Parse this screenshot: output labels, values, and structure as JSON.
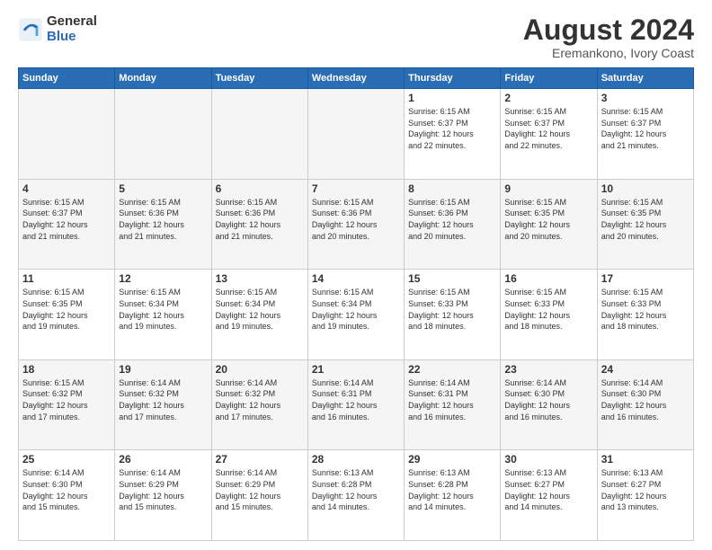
{
  "header": {
    "logo_general": "General",
    "logo_blue": "Blue",
    "month_year": "August 2024",
    "location": "Eremankono, Ivory Coast"
  },
  "days_of_week": [
    "Sunday",
    "Monday",
    "Tuesday",
    "Wednesday",
    "Thursday",
    "Friday",
    "Saturday"
  ],
  "weeks": [
    [
      {
        "day": "",
        "info": ""
      },
      {
        "day": "",
        "info": ""
      },
      {
        "day": "",
        "info": ""
      },
      {
        "day": "",
        "info": ""
      },
      {
        "day": "1",
        "info": "Sunrise: 6:15 AM\nSunset: 6:37 PM\nDaylight: 12 hours\nand 22 minutes."
      },
      {
        "day": "2",
        "info": "Sunrise: 6:15 AM\nSunset: 6:37 PM\nDaylight: 12 hours\nand 22 minutes."
      },
      {
        "day": "3",
        "info": "Sunrise: 6:15 AM\nSunset: 6:37 PM\nDaylight: 12 hours\nand 21 minutes."
      }
    ],
    [
      {
        "day": "4",
        "info": "Sunrise: 6:15 AM\nSunset: 6:37 PM\nDaylight: 12 hours\nand 21 minutes."
      },
      {
        "day": "5",
        "info": "Sunrise: 6:15 AM\nSunset: 6:36 PM\nDaylight: 12 hours\nand 21 minutes."
      },
      {
        "day": "6",
        "info": "Sunrise: 6:15 AM\nSunset: 6:36 PM\nDaylight: 12 hours\nand 21 minutes."
      },
      {
        "day": "7",
        "info": "Sunrise: 6:15 AM\nSunset: 6:36 PM\nDaylight: 12 hours\nand 20 minutes."
      },
      {
        "day": "8",
        "info": "Sunrise: 6:15 AM\nSunset: 6:36 PM\nDaylight: 12 hours\nand 20 minutes."
      },
      {
        "day": "9",
        "info": "Sunrise: 6:15 AM\nSunset: 6:35 PM\nDaylight: 12 hours\nand 20 minutes."
      },
      {
        "day": "10",
        "info": "Sunrise: 6:15 AM\nSunset: 6:35 PM\nDaylight: 12 hours\nand 20 minutes."
      }
    ],
    [
      {
        "day": "11",
        "info": "Sunrise: 6:15 AM\nSunset: 6:35 PM\nDaylight: 12 hours\nand 19 minutes."
      },
      {
        "day": "12",
        "info": "Sunrise: 6:15 AM\nSunset: 6:34 PM\nDaylight: 12 hours\nand 19 minutes."
      },
      {
        "day": "13",
        "info": "Sunrise: 6:15 AM\nSunset: 6:34 PM\nDaylight: 12 hours\nand 19 minutes."
      },
      {
        "day": "14",
        "info": "Sunrise: 6:15 AM\nSunset: 6:34 PM\nDaylight: 12 hours\nand 19 minutes."
      },
      {
        "day": "15",
        "info": "Sunrise: 6:15 AM\nSunset: 6:33 PM\nDaylight: 12 hours\nand 18 minutes."
      },
      {
        "day": "16",
        "info": "Sunrise: 6:15 AM\nSunset: 6:33 PM\nDaylight: 12 hours\nand 18 minutes."
      },
      {
        "day": "17",
        "info": "Sunrise: 6:15 AM\nSunset: 6:33 PM\nDaylight: 12 hours\nand 18 minutes."
      }
    ],
    [
      {
        "day": "18",
        "info": "Sunrise: 6:15 AM\nSunset: 6:32 PM\nDaylight: 12 hours\nand 17 minutes."
      },
      {
        "day": "19",
        "info": "Sunrise: 6:14 AM\nSunset: 6:32 PM\nDaylight: 12 hours\nand 17 minutes."
      },
      {
        "day": "20",
        "info": "Sunrise: 6:14 AM\nSunset: 6:32 PM\nDaylight: 12 hours\nand 17 minutes."
      },
      {
        "day": "21",
        "info": "Sunrise: 6:14 AM\nSunset: 6:31 PM\nDaylight: 12 hours\nand 16 minutes."
      },
      {
        "day": "22",
        "info": "Sunrise: 6:14 AM\nSunset: 6:31 PM\nDaylight: 12 hours\nand 16 minutes."
      },
      {
        "day": "23",
        "info": "Sunrise: 6:14 AM\nSunset: 6:30 PM\nDaylight: 12 hours\nand 16 minutes."
      },
      {
        "day": "24",
        "info": "Sunrise: 6:14 AM\nSunset: 6:30 PM\nDaylight: 12 hours\nand 16 minutes."
      }
    ],
    [
      {
        "day": "25",
        "info": "Sunrise: 6:14 AM\nSunset: 6:30 PM\nDaylight: 12 hours\nand 15 minutes."
      },
      {
        "day": "26",
        "info": "Sunrise: 6:14 AM\nSunset: 6:29 PM\nDaylight: 12 hours\nand 15 minutes."
      },
      {
        "day": "27",
        "info": "Sunrise: 6:14 AM\nSunset: 6:29 PM\nDaylight: 12 hours\nand 15 minutes."
      },
      {
        "day": "28",
        "info": "Sunrise: 6:13 AM\nSunset: 6:28 PM\nDaylight: 12 hours\nand 14 minutes."
      },
      {
        "day": "29",
        "info": "Sunrise: 6:13 AM\nSunset: 6:28 PM\nDaylight: 12 hours\nand 14 minutes."
      },
      {
        "day": "30",
        "info": "Sunrise: 6:13 AM\nSunset: 6:27 PM\nDaylight: 12 hours\nand 14 minutes."
      },
      {
        "day": "31",
        "info": "Sunrise: 6:13 AM\nSunset: 6:27 PM\nDaylight: 12 hours\nand 13 minutes."
      }
    ]
  ]
}
